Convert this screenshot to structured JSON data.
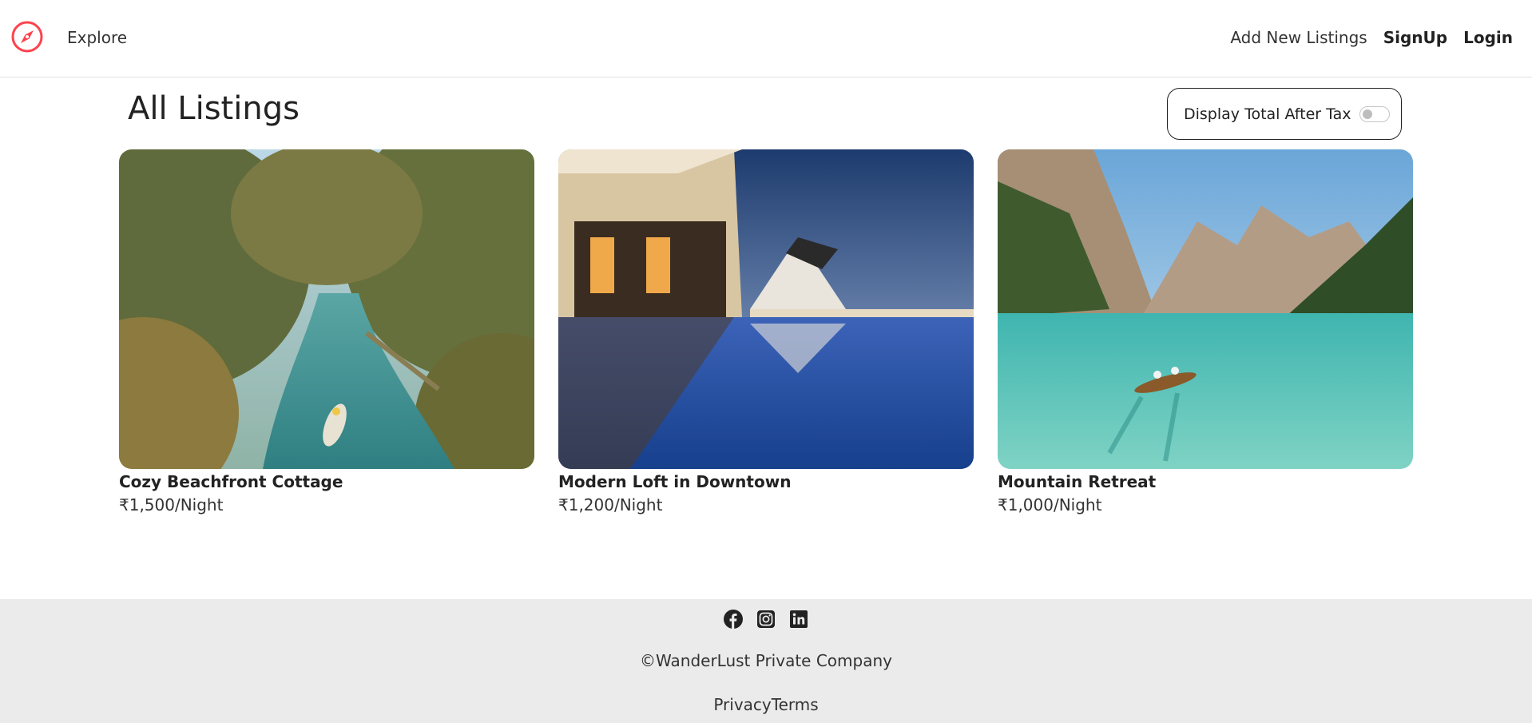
{
  "nav": {
    "explore_label": "Explore",
    "add_listing_label": "Add New Listings",
    "signup_label": "SignUp",
    "login_label": "Login",
    "brand_color": "#fe424d"
  },
  "page": {
    "title": "All Listings",
    "tax_toggle_label": "Display Total After Tax",
    "tax_toggle_on": false
  },
  "listings": [
    {
      "title": "Cozy Beachfront Cottage",
      "price": "₹1,500/Night",
      "image": "tropical palm river with canoe"
    },
    {
      "title": "Modern Loft in Downtown",
      "price": "₹1,200/Night",
      "image": "resort pool at dusk"
    },
    {
      "title": "Mountain Retreat",
      "price": "₹1,000/Night",
      "image": "mountain lake with rowboat"
    }
  ],
  "footer": {
    "social_icons": [
      "facebook-icon",
      "instagram-icon",
      "linkedin-icon"
    ],
    "copyright": "©WanderLust Private Company",
    "privacy_label": "Privacy",
    "terms_label": "Terms"
  }
}
